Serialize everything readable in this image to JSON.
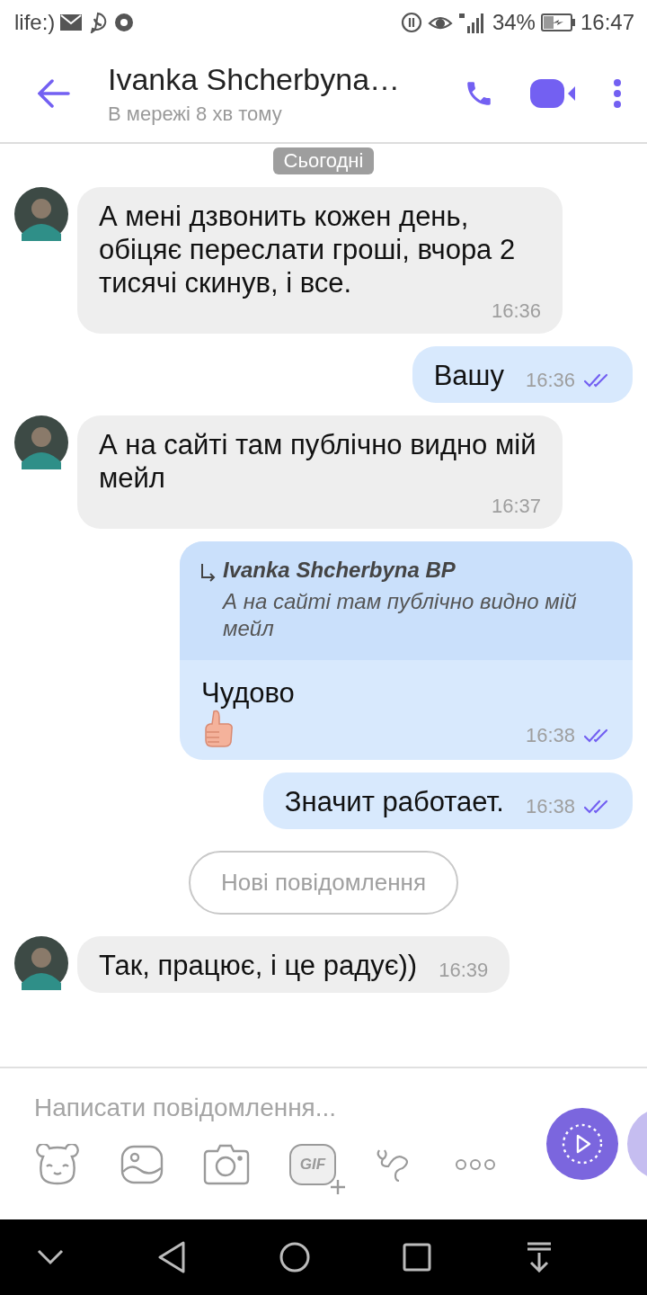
{
  "status_bar": {
    "carrier": "life:)",
    "battery": "34%",
    "time": "16:47"
  },
  "header": {
    "title": "Ivanka Shcherbyna…",
    "subtitle": "В мережі 8 хв тому"
  },
  "date_label": "Сьогодні",
  "messages": [
    {
      "kind": "incoming",
      "text": "А мені дзвонить кожен день, обіцяє переслати гроші, вчора 2 тисячі скинув, і все.",
      "time": "16:36"
    },
    {
      "kind": "outgoing",
      "text": "Вашу",
      "time": "16:36",
      "read": true
    },
    {
      "kind": "incoming",
      "text": "А на сайті там публічно видно мій мейл",
      "time": "16:37"
    },
    {
      "kind": "outgoing",
      "reply": {
        "author": "Ivanka Shcherbyna BP",
        "text": "А на сайті там публічно видно мій мейл"
      },
      "text": "Чудово",
      "thumbs_up": true,
      "time": "16:38",
      "read": true
    },
    {
      "kind": "outgoing",
      "text": "Значит работает.",
      "time": "16:38",
      "read": true
    },
    {
      "kind": "divider",
      "text": "Нові повідомлення"
    },
    {
      "kind": "incoming",
      "text": "Так, працює, і це радує))",
      "time": "16:39"
    }
  ],
  "composer": {
    "placeholder": "Написати повідомлення...",
    "gif_label": "GIF"
  }
}
